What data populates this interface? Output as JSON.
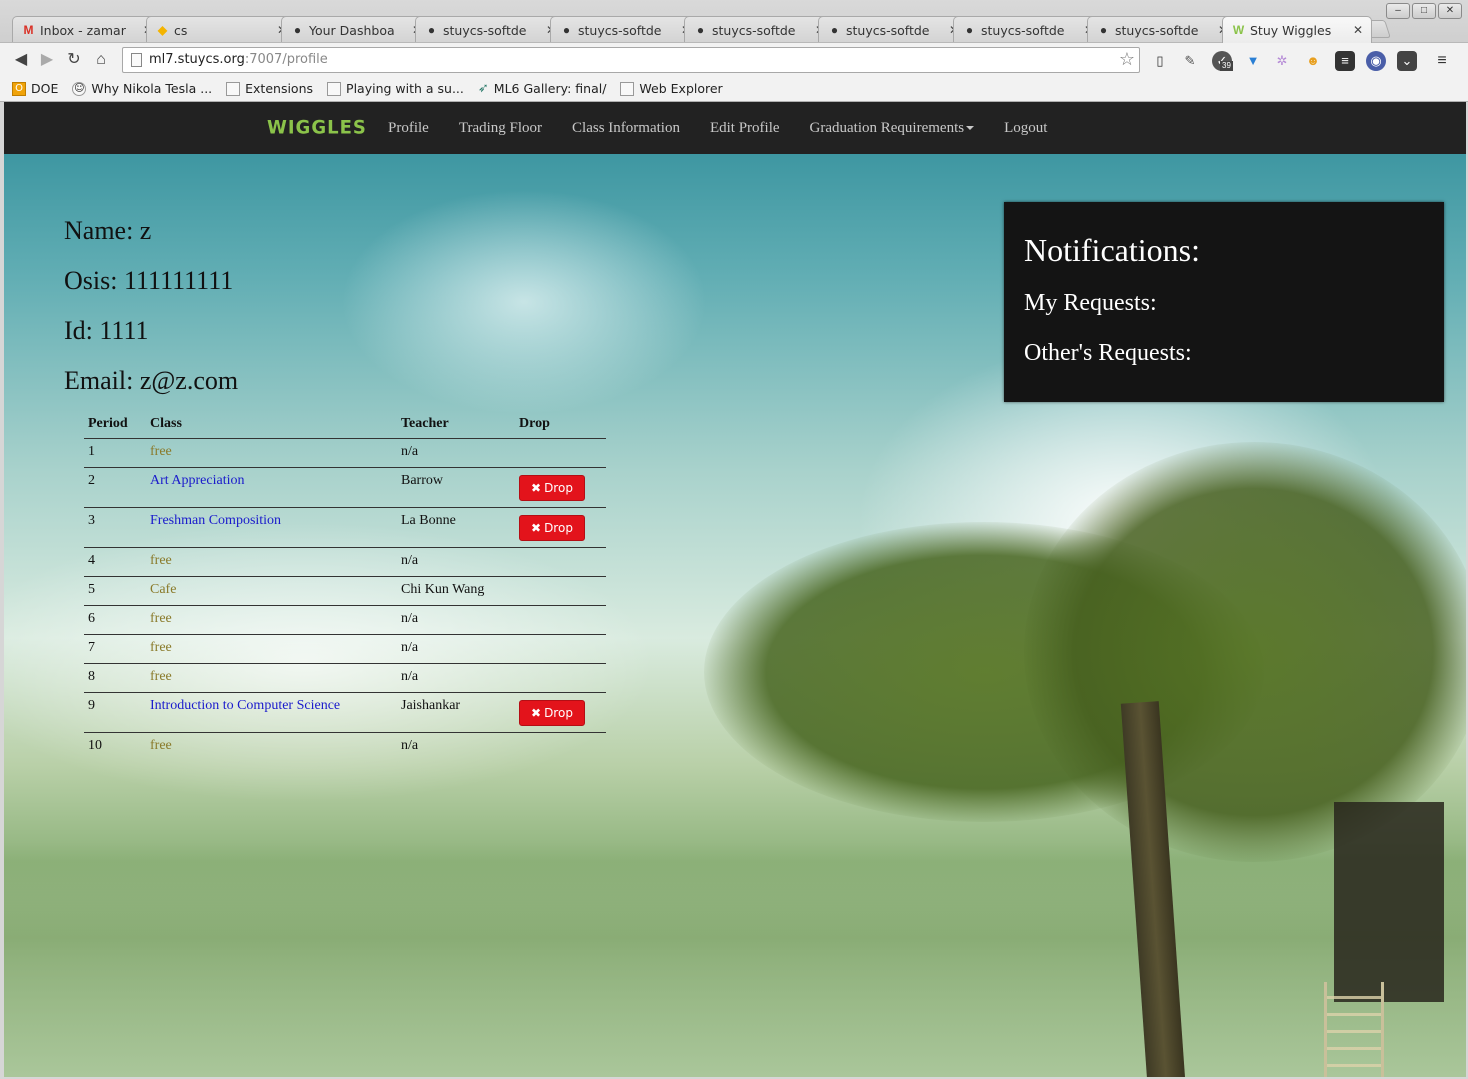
{
  "tabs": [
    {
      "title": "Inbox - zamar",
      "favicon": "gmail-icon",
      "active": false
    },
    {
      "title": "cs",
      "favicon": "drive-icon",
      "active": false
    },
    {
      "title": "Your Dashboa",
      "favicon": "github-icon",
      "active": false
    },
    {
      "title": "stuycs-softde",
      "favicon": "github-icon",
      "active": false
    },
    {
      "title": "stuycs-softde",
      "favicon": "github-icon",
      "active": false
    },
    {
      "title": "stuycs-softde",
      "favicon": "github-icon",
      "active": false
    },
    {
      "title": "stuycs-softde",
      "favicon": "github-icon",
      "active": false
    },
    {
      "title": "stuycs-softde",
      "favicon": "github-icon",
      "active": false
    },
    {
      "title": "stuycs-softde",
      "favicon": "github-icon",
      "active": false
    },
    {
      "title": "Stuy Wiggles",
      "favicon": "wiggles-icon",
      "active": true
    }
  ],
  "omnibox": {
    "host": "ml7.stuycs.org",
    "rest": ":7007/profile"
  },
  "extension_badge": "39",
  "bookmarks": [
    {
      "label": "DOE",
      "icon": "doe-icon"
    },
    {
      "label": "Why Nikola Tesla ...",
      "icon": "reddit-icon"
    },
    {
      "label": "Extensions",
      "icon": "page-icon"
    },
    {
      "label": "Playing with a su...",
      "icon": "page-icon"
    },
    {
      "label": "ML6 Gallery: final/",
      "icon": "bird-icon"
    },
    {
      "label": "Web Explorer",
      "icon": "page-icon"
    }
  ],
  "navbar": {
    "brand": "WIGGLES",
    "links": [
      "Profile",
      "Trading Floor",
      "Class Information",
      "Edit Profile",
      "Graduation Requirements",
      "Logout"
    ]
  },
  "profile": {
    "name": "Name: z",
    "osis": "Osis: 111111111",
    "id": "Id: 1111",
    "email": "Email: z@z.com"
  },
  "schedule": {
    "headers": [
      "Period",
      "Class",
      "Teacher",
      "Drop"
    ],
    "drop_label": "Drop",
    "rows": [
      {
        "period": "1",
        "class": "free",
        "teacher": "n/a",
        "kind": "free",
        "droppable": false
      },
      {
        "period": "2",
        "class": "Art Appreciation",
        "teacher": "Barrow",
        "kind": "link",
        "droppable": true
      },
      {
        "period": "3",
        "class": "Freshman Composition",
        "teacher": "La Bonne",
        "kind": "link",
        "droppable": true
      },
      {
        "period": "4",
        "class": "free",
        "teacher": "n/a",
        "kind": "free",
        "droppable": false
      },
      {
        "period": "5",
        "class": "Cafe",
        "teacher": "Chi Kun Wang",
        "kind": "free",
        "droppable": false
      },
      {
        "period": "6",
        "class": "free",
        "teacher": "n/a",
        "kind": "free",
        "droppable": false
      },
      {
        "period": "7",
        "class": "free",
        "teacher": "n/a",
        "kind": "free",
        "droppable": false
      },
      {
        "period": "8",
        "class": "free",
        "teacher": "n/a",
        "kind": "free",
        "droppable": false
      },
      {
        "period": "9",
        "class": "Introduction to Computer Science",
        "teacher": "Jaishankar",
        "kind": "link",
        "droppable": true
      },
      {
        "period": "10",
        "class": "free",
        "teacher": "n/a",
        "kind": "free",
        "droppable": false
      }
    ]
  },
  "notifications": {
    "title": "Notifications:",
    "my_requests": "My Requests:",
    "others_requests": "Other's Requests:"
  },
  "colors": {
    "navbar_bg": "#222222",
    "brand_green": "#8bc34a",
    "drop_red": "#e3131b",
    "free_class": "#8a7a2a",
    "class_link": "#1a1acc",
    "notif_bg": "#141414"
  }
}
